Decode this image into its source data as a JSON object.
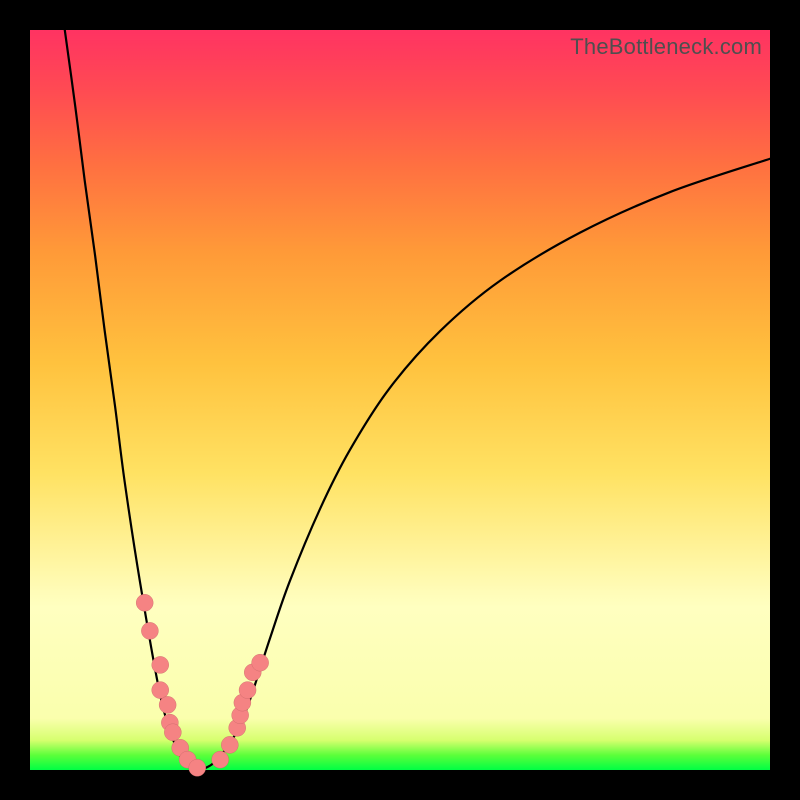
{
  "watermark": "TheBottleneck.com",
  "colors": {
    "frame": "#000000",
    "curve": "#000000",
    "dot_fill": "#f58383",
    "dot_stroke": "#c96868"
  },
  "chart_data": {
    "type": "line",
    "title": "",
    "xlabel": "",
    "ylabel": "",
    "xlim": [
      0,
      100
    ],
    "ylim": [
      0,
      100
    ],
    "grid": false,
    "axes_visible": false,
    "note": "No numeric tick labels are present; x and y are normalized 0–100 estimates from pixel positions.",
    "series": [
      {
        "name": "left-branch",
        "x": [
          4.7,
          6.1,
          7.4,
          8.8,
          10.1,
          11.5,
          12.8,
          14.9,
          17.6,
          19.6,
          20.9,
          22.3
        ],
        "y": [
          100,
          89.8,
          79.6,
          69.5,
          59.3,
          49.1,
          38.9,
          25.2,
          10.1,
          3.4,
          1.1,
          0.2
        ]
      },
      {
        "name": "right-branch",
        "x": [
          23.6,
          25.0,
          27.0,
          28.4,
          29.7,
          32.4,
          35.1,
          39.2,
          43.2,
          48.6,
          55.4,
          63.5,
          74.3,
          86.5,
          100.0
        ],
        "y": [
          0.2,
          1.1,
          3.6,
          6.1,
          9.4,
          17.7,
          25.5,
          35.3,
          43.2,
          51.6,
          59.3,
          66.1,
          72.6,
          78.1,
          82.6
        ]
      }
    ],
    "scatter": [
      {
        "name": "dots",
        "x": [
          15.5,
          16.2,
          17.6,
          17.6,
          18.6,
          18.9,
          19.3,
          20.3,
          21.3,
          22.6,
          25.7,
          27.0,
          28.0,
          28.4,
          28.7,
          29.4,
          30.1,
          31.1
        ],
        "y": [
          22.6,
          18.8,
          14.2,
          10.8,
          8.8,
          6.4,
          5.1,
          3.0,
          1.4,
          0.3,
          1.4,
          3.4,
          5.7,
          7.4,
          9.1,
          10.8,
          13.2,
          14.5
        ]
      }
    ]
  }
}
